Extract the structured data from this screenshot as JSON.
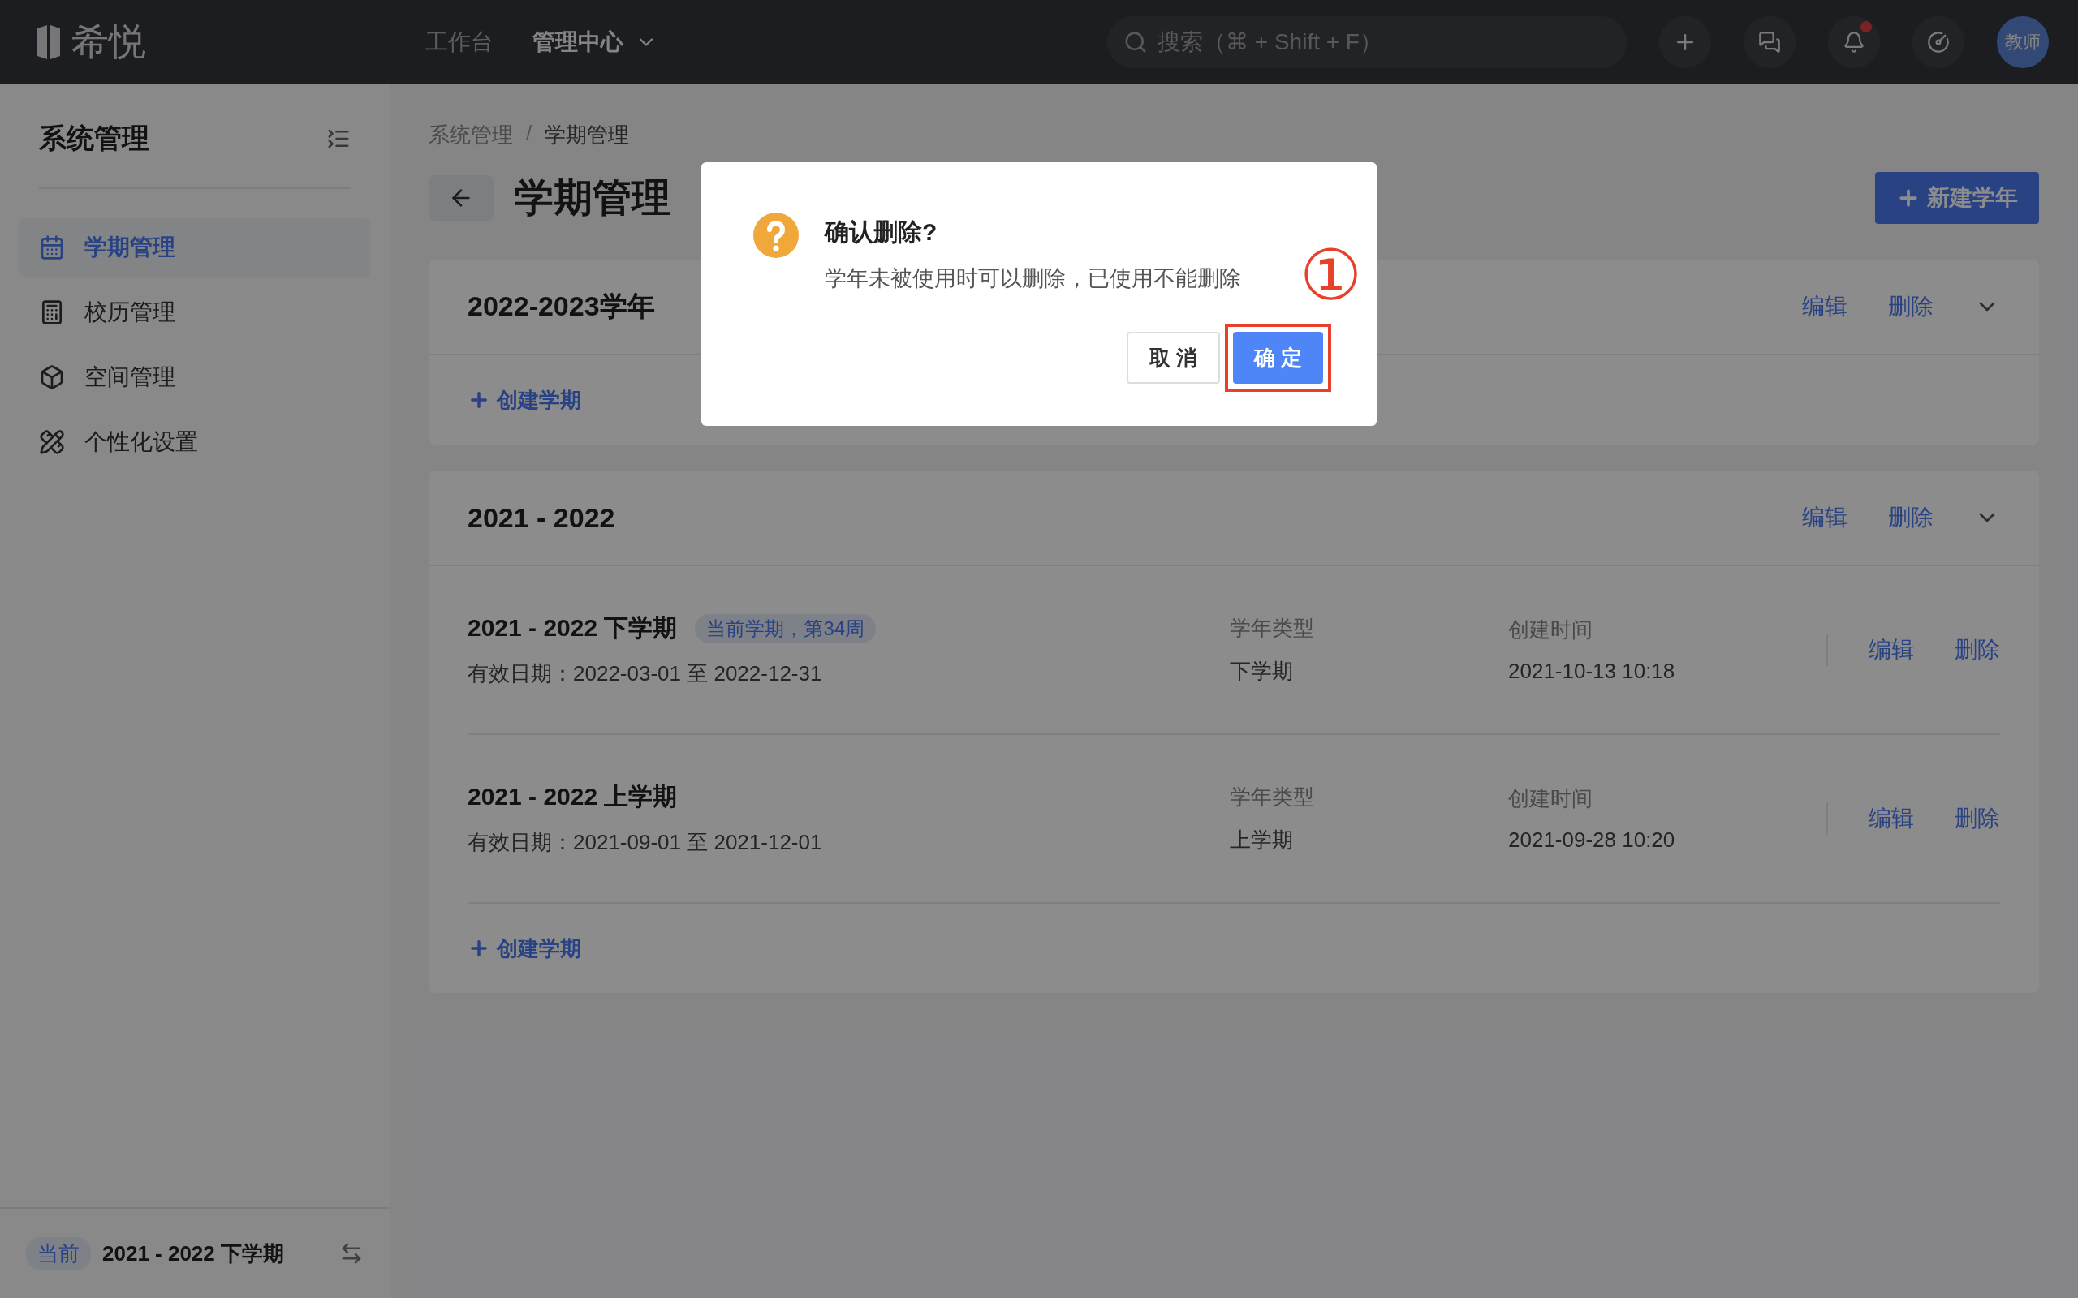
{
  "top_bar": {
    "logo": "希悦",
    "nav": [
      {
        "label": "工作台",
        "selected": false,
        "dropdown": false
      },
      {
        "label": "管理中心",
        "selected": true,
        "dropdown": true
      }
    ],
    "search": {
      "placeholder": "搜索（⌘ + Shift + F）"
    },
    "notification_dot": true,
    "avatar": "教师"
  },
  "sidebar": {
    "title": "系统管理",
    "items": [
      {
        "label": "学期管理",
        "selected": true
      },
      {
        "label": "校历管理",
        "selected": false
      },
      {
        "label": "空间管理",
        "selected": false
      },
      {
        "label": "个性化设置",
        "selected": false
      }
    ],
    "footer": {
      "badge": "当前",
      "term": "2021 - 2022 下学期"
    }
  },
  "breadcrumb": {
    "items": [
      "系统管理",
      "学期管理"
    ],
    "separator": "/"
  },
  "page": {
    "title": "学期管理",
    "new_button": "新建学年"
  },
  "years": [
    {
      "title": "2022-2023学年",
      "actions": [
        "编辑",
        "删除"
      ],
      "add_term": "创建学期"
    },
    {
      "title": "2021 - 2022",
      "actions": [
        "编辑",
        "删除"
      ],
      "terms": [
        {
          "title": "2021 - 2022 下学期",
          "badge": "当前学期，第34周",
          "dates": "有效日期：2022-03-01 至 2022-12-31",
          "type_label": "学年类型",
          "type": "下学期",
          "created_label": "创建时间",
          "created": "2021-10-13 10:18",
          "actions": [
            "编辑",
            "删除"
          ]
        },
        {
          "title": "2021 - 2022 上学期",
          "dates": "有效日期：2021-09-01 至 2021-12-01",
          "type_label": "学年类型",
          "type": "上学期",
          "created_label": "创建时间",
          "created": "2021-09-28 10:20",
          "actions": [
            "编辑",
            "删除"
          ]
        }
      ],
      "add_term": "创建学期"
    }
  ],
  "dialog": {
    "title": "确认删除?",
    "message": "学年未被使用时可以删除，已使用不能删除",
    "cancel": "取 消",
    "confirm": "确 定",
    "confirm_highlighted": true,
    "annotation": "①"
  }
}
